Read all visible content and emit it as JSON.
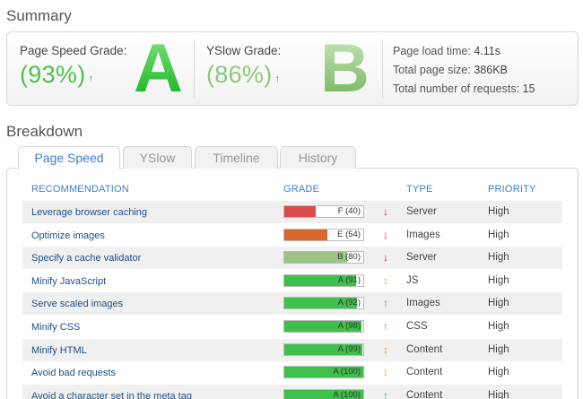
{
  "summary": {
    "title": "Summary",
    "pagespeed": {
      "label": "Page Speed Grade:",
      "percent": "(93%)",
      "grade": "A",
      "trend": "↑"
    },
    "yslow": {
      "label": "YSlow Grade:",
      "percent": "(86%)",
      "grade": "B",
      "trend": "↑"
    },
    "stats": {
      "load_time_label": "Page load time:",
      "load_time": "4.11s",
      "page_size_label": "Total page size:",
      "page_size": "386KB",
      "requests_label": "Total number of requests:",
      "requests": "15"
    }
  },
  "breakdown": {
    "title": "Breakdown",
    "tabs": [
      {
        "label": "Page Speed"
      },
      {
        "label": "YSlow"
      },
      {
        "label": "Timeline"
      },
      {
        "label": "History"
      }
    ],
    "columns": {
      "recommendation": "RECOMMENDATION",
      "grade": "GRADE",
      "type": "TYPE",
      "priority": "PRIORITY"
    },
    "rows": [
      {
        "recommendation": "Leverage browser caching",
        "grade_label": "F (40)",
        "score": 40,
        "bar_color": "#d94a4a",
        "arrow": "↓",
        "arrow_color": "#cc2222",
        "type": "Server",
        "priority": "High"
      },
      {
        "recommendation": "Optimize images",
        "grade_label": "E (54)",
        "score": 54,
        "bar_color": "#d9662a",
        "arrow": "↓",
        "arrow_color": "#cc2222",
        "type": "Images",
        "priority": "High"
      },
      {
        "recommendation": "Specify a cache validator",
        "grade_label": "B (80)",
        "score": 80,
        "bar_color": "#9cc585",
        "arrow": "↓",
        "arrow_color": "#cc2222",
        "type": "Server",
        "priority": "High"
      },
      {
        "recommendation": "Minify JavaScript",
        "grade_label": "A (91)",
        "score": 91,
        "bar_color": "#3fbf4c",
        "arrow": "↕",
        "arrow_color": "#e8a23a",
        "type": "JS",
        "priority": "High"
      },
      {
        "recommendation": "Serve scaled images",
        "grade_label": "A (92)",
        "score": 92,
        "bar_color": "#3fbf4c",
        "arrow": "↑",
        "arrow_color": "#3fae3f",
        "type": "Images",
        "priority": "High"
      },
      {
        "recommendation": "Minify CSS",
        "grade_label": "A (98)",
        "score": 98,
        "bar_color": "#3fbf4c",
        "arrow": "↑",
        "arrow_color": "#3fae3f",
        "type": "CSS",
        "priority": "High"
      },
      {
        "recommendation": "Minify HTML",
        "grade_label": "A (99)",
        "score": 99,
        "bar_color": "#3fbf4c",
        "arrow": "↕",
        "arrow_color": "#e8a23a",
        "type": "Content",
        "priority": "High"
      },
      {
        "recommendation": "Avoid bad requests",
        "grade_label": "A (100)",
        "score": 100,
        "bar_color": "#3fbf4c",
        "arrow": "↕",
        "arrow_color": "#e8a23a",
        "type": "Content",
        "priority": "High"
      },
      {
        "recommendation": "Avoid a character set in the meta tag",
        "grade_label": "A (100)",
        "score": 100,
        "bar_color": "#3fbf4c",
        "arrow": "↑",
        "arrow_color": "#3fae3f",
        "type": "Content",
        "priority": "High"
      }
    ]
  }
}
